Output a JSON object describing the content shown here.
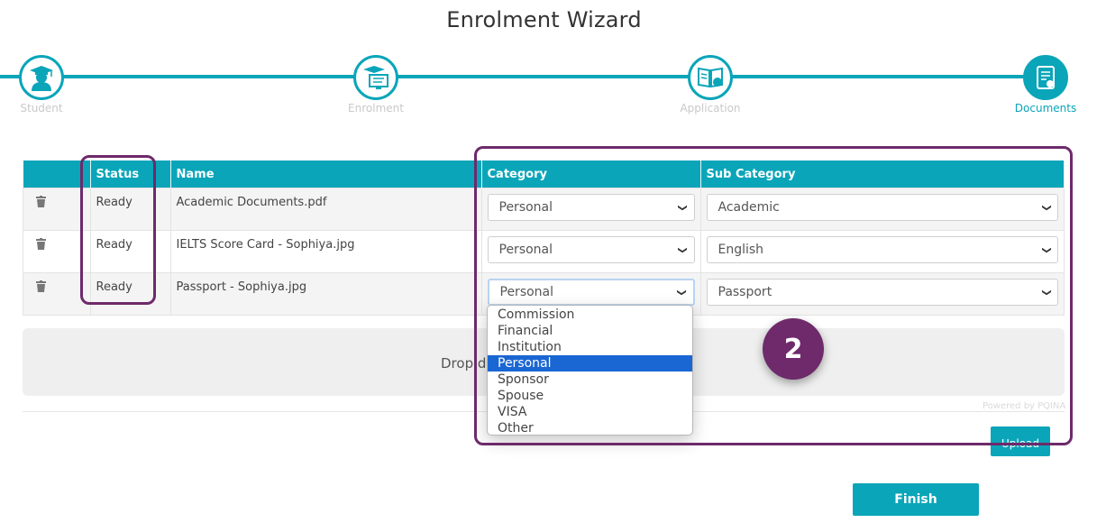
{
  "page": {
    "title": "Enrolment Wizard"
  },
  "steps": [
    {
      "label": "Student",
      "icon": "student-icon"
    },
    {
      "label": "Enrolment",
      "icon": "enrolment-icon"
    },
    {
      "label": "Application",
      "icon": "application-icon"
    },
    {
      "label": "Documents",
      "icon": "documents-icon",
      "active": true
    }
  ],
  "table": {
    "headers": {
      "status": "Status",
      "name": "Name",
      "category": "Category",
      "sub_category": "Sub Category"
    },
    "rows": [
      {
        "status": "Ready",
        "name": "Academic Documents.pdf",
        "category": "Personal",
        "sub_category": "Academic"
      },
      {
        "status": "Ready",
        "name": "IELTS Score Card - Sophiya.jpg",
        "category": "Personal",
        "sub_category": "English"
      },
      {
        "status": "Ready",
        "name": "Passport - Sophiya.jpg",
        "category": "Personal",
        "sub_category": "Passport"
      }
    ]
  },
  "dropzone": {
    "text": "Drop d",
    "powered": "Powered by PQINA"
  },
  "category_dropdown": {
    "options": [
      "Commission",
      "Financial",
      "Institution",
      "Personal",
      "Sponsor",
      "Spouse",
      "VISA",
      "Other"
    ],
    "selected": "Personal"
  },
  "buttons": {
    "upload": "Upload",
    "finish": "Finish"
  },
  "annotation": {
    "badge": "2"
  },
  "colors": {
    "accent": "#0aa5b9",
    "annotation": "#6e2a6a",
    "selected_option": "#1a66d2"
  }
}
